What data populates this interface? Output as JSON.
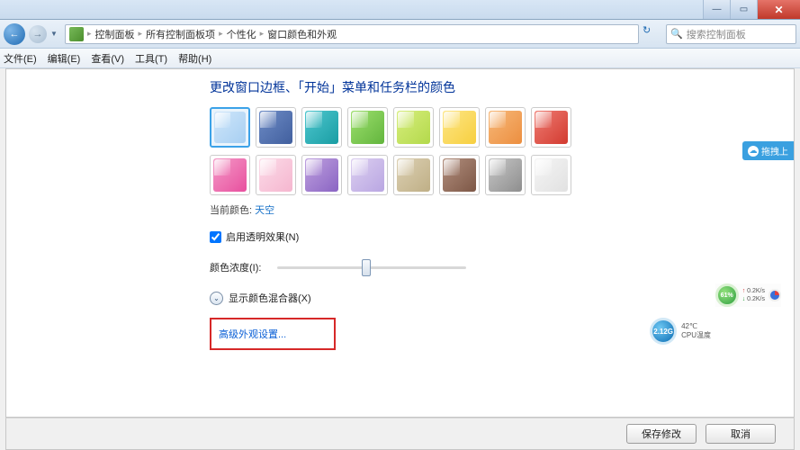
{
  "titlebar": {
    "min": "—",
    "max": "▭",
    "close": "✕"
  },
  "nav": {
    "back": "←",
    "forward": "→",
    "dropdown": "▼",
    "refresh": "↻"
  },
  "breadcrumb": {
    "items": [
      "控制面板",
      "所有控制面板项",
      "个性化",
      "窗口颜色和外观"
    ],
    "sep": "▸"
  },
  "search": {
    "placeholder": "搜索控制面板",
    "icon": "🔍"
  },
  "menu": {
    "file": "文件(E)",
    "edit": "编辑(E)",
    "view": "查看(V)",
    "tools": "工具(T)",
    "help": "帮助(H)"
  },
  "heading": "更改窗口边框、「开始」菜单和任务栏的颜色",
  "colors_row1": [
    {
      "name": "sky",
      "bg": "linear-gradient(135deg,#cfe6fa,#a7cff2)",
      "selected": true
    },
    {
      "name": "twilight",
      "bg": "linear-gradient(135deg,#6e8cc6,#415f9e)"
    },
    {
      "name": "sea",
      "bg": "linear-gradient(135deg,#4fc7cf,#199da3)"
    },
    {
      "name": "leaf",
      "bg": "linear-gradient(135deg,#9ee06e,#62b53d)"
    },
    {
      "name": "lime",
      "bg": "linear-gradient(135deg,#d7ee7d,#b3d94b)"
    },
    {
      "name": "sun",
      "bg": "linear-gradient(135deg,#fde686,#f7cf3f)"
    },
    {
      "name": "pumpkin",
      "bg": "linear-gradient(135deg,#f7b97a,#ec8e3f)"
    },
    {
      "name": "ruby",
      "bg": "linear-gradient(135deg,#ef7d74,#d23a2f)"
    }
  ],
  "colors_row2": [
    {
      "name": "fuchsia",
      "bg": "linear-gradient(135deg,#f49bc8,#e84f9e)"
    },
    {
      "name": "blush",
      "bg": "linear-gradient(135deg,#fcdbe8,#f5b6cf)"
    },
    {
      "name": "violet",
      "bg": "linear-gradient(135deg,#bfa1df,#8a64c3)"
    },
    {
      "name": "lavender",
      "bg": "linear-gradient(135deg,#dccff0,#b9a6e2)"
    },
    {
      "name": "taupe",
      "bg": "linear-gradient(135deg,#dcd0b3,#bfaf86)"
    },
    {
      "name": "chocolate",
      "bg": "linear-gradient(135deg,#b28f7e,#7d5746)"
    },
    {
      "name": "slate",
      "bg": "linear-gradient(135deg,#c7c7c7,#8e8e8e)"
    },
    {
      "name": "frost",
      "bg": "linear-gradient(135deg,#f5f5f5,#e1e1e1)"
    }
  ],
  "current_color": {
    "label": "当前颜色:",
    "value": "天空"
  },
  "transparency": {
    "label": "启用透明效果(N)",
    "checked": true
  },
  "intensity": {
    "label": "颜色浓度(I):"
  },
  "mixer": {
    "label": "显示颜色混合器(X)",
    "chevron": "⌄"
  },
  "advanced_link": "高级外观设置...",
  "buttons": {
    "save": "保存修改",
    "cancel": "取消"
  },
  "side_badge": "拖拽上",
  "cpu_widget": {
    "value": "2.12G",
    "temp": "42℃",
    "label": "CPU温度"
  },
  "net_widget": {
    "pct": "61%",
    "up": "0.2K/s",
    "down": "0.2K/s"
  }
}
